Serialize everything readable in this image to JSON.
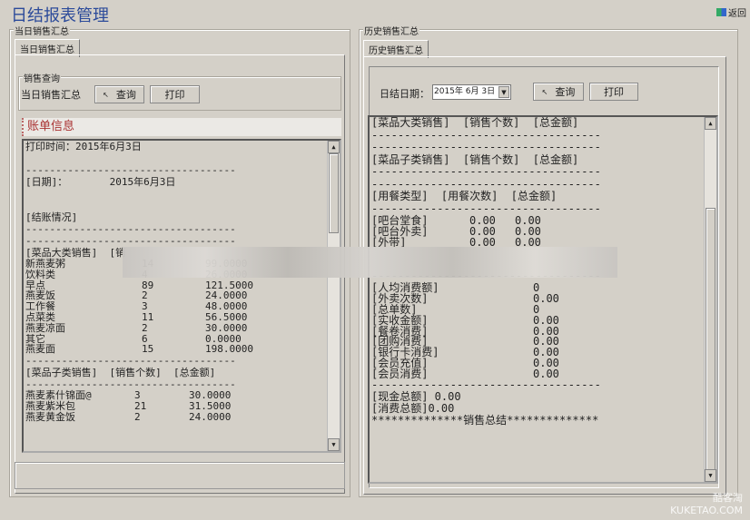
{
  "window": {
    "title": "日结报表管理",
    "back_label": "返回"
  },
  "left": {
    "group_label": "当日销售汇总",
    "tab_label": "当日销售汇总",
    "query_group_label": "销售查询",
    "query_label": "当日销售汇总",
    "query_button": "查询",
    "print_button": "打印",
    "bill_header": "账单信息",
    "lines_top": [
      "打印时间：2015年6月3日",
      "",
      "-----------------------------------",
      "[日期]：       2015年6月3日",
      "",
      "",
      "[结账情况]",
      "-----------------------------------",
      "-----------------------------------",
      "[菜品大类销售]  [销"
    ],
    "category_rows": [
      [
        "新燕麦粥",
        "14",
        "99.0000"
      ],
      [
        "饮料类",
        "4",
        "26.0000"
      ],
      [
        "早点",
        "89",
        "121.5000"
      ],
      [
        "燕麦饭",
        "2",
        "24.0000"
      ],
      [
        "工作餐",
        "3",
        "48.0000"
      ],
      [
        "点菜类",
        "11",
        "56.5000"
      ],
      [
        "燕麦凉面",
        "2",
        "30.0000"
      ],
      [
        "其它",
        "6",
        "0.0000"
      ],
      [
        "燕麦面",
        "15",
        "198.0000"
      ]
    ],
    "sub_header": "[菜品子类销售]  [销售个数]  [总金额]",
    "sub_rows": [
      [
        "燕麦素什锦面@",
        "3",
        "30.0000"
      ],
      [
        "燕麦紫米包",
        "21",
        "31.5000"
      ],
      [
        "燕麦黄金饭",
        "2",
        "24.0000"
      ]
    ]
  },
  "right": {
    "group_label": "历史销售汇总",
    "tab_label": "历史销售汇总",
    "date_label": "日结日期：",
    "date_value": "2015年 6月 3日",
    "query_button": "查询",
    "print_button": "打印",
    "lines": [
      "[菜品大类销售]  [销售个数]  [总金额]",
      "-----------------------------------",
      "-----------------------------------",
      "[菜品子类销售]  [销售个数]  [总金额]",
      "-----------------------------------",
      "-----------------------------------",
      "[用餐类型]  [用餐次数]  [总金额]",
      "-----------------------------------"
    ],
    "meal_rows": [
      [
        "[吧台堂食]",
        "0.00",
        "0.00"
      ],
      [
        "[吧台外卖]",
        "0.00",
        "0.00"
      ],
      [
        "[外带]",
        "0.00",
        "0.00"
      ]
    ],
    "stat_rows": [
      [
        "[人均消费额]",
        "0"
      ],
      [
        "[外卖次数]",
        "0.00"
      ],
      [
        "[总单数]",
        "0"
      ],
      [
        "[实收金额]",
        "0.00"
      ],
      [
        "[餐卷消费]",
        "0.00"
      ],
      [
        "[团购消费]",
        "0.00"
      ],
      [
        "[银行卡消费]",
        "0.00"
      ],
      [
        "[会员充值]",
        "0.00"
      ],
      [
        "[会员消费]",
        "0.00"
      ]
    ],
    "cash_total": "[现金总额] 0.00",
    "consume_total": "[消费总额]0.00",
    "summary": "**************销售总结**************"
  },
  "watermark": "酷客淘 KUKETAO.COM"
}
